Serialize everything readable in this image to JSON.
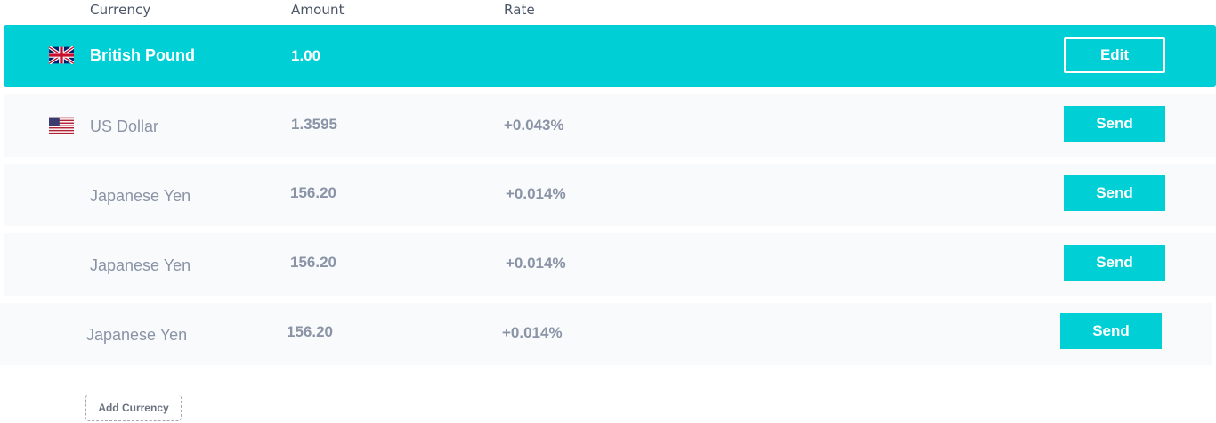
{
  "header": {
    "currency": "Currency",
    "amount": "Amount",
    "rate": "Rate"
  },
  "base_row": {
    "flag_icon": "uk-flag-icon",
    "currency": "British Pound",
    "amount": "1.00",
    "rate": "",
    "action": "Edit"
  },
  "rows": [
    {
      "flag_icon": "us-flag-icon",
      "currency": "US Dollar",
      "amount": "1.3595",
      "rate": "+0.043%",
      "action": "Send"
    },
    {
      "flag_icon": "",
      "currency": "Japanese Yen",
      "amount": "156.20",
      "rate": "+0.014%",
      "action": "Send"
    },
    {
      "flag_icon": "",
      "currency": "Japanese Yen",
      "amount": "156.20",
      "rate": "+0.014%",
      "action": "Send"
    },
    {
      "flag_icon": "",
      "currency": "Japanese Yen",
      "amount": "156.20",
      "rate": "+0.014%",
      "action": "Send"
    }
  ],
  "add_button": "Add Currency",
  "colors": {
    "accent": "#00cfd6",
    "row_bg": "#f9fafb",
    "muted_text": "#8a94a6"
  }
}
